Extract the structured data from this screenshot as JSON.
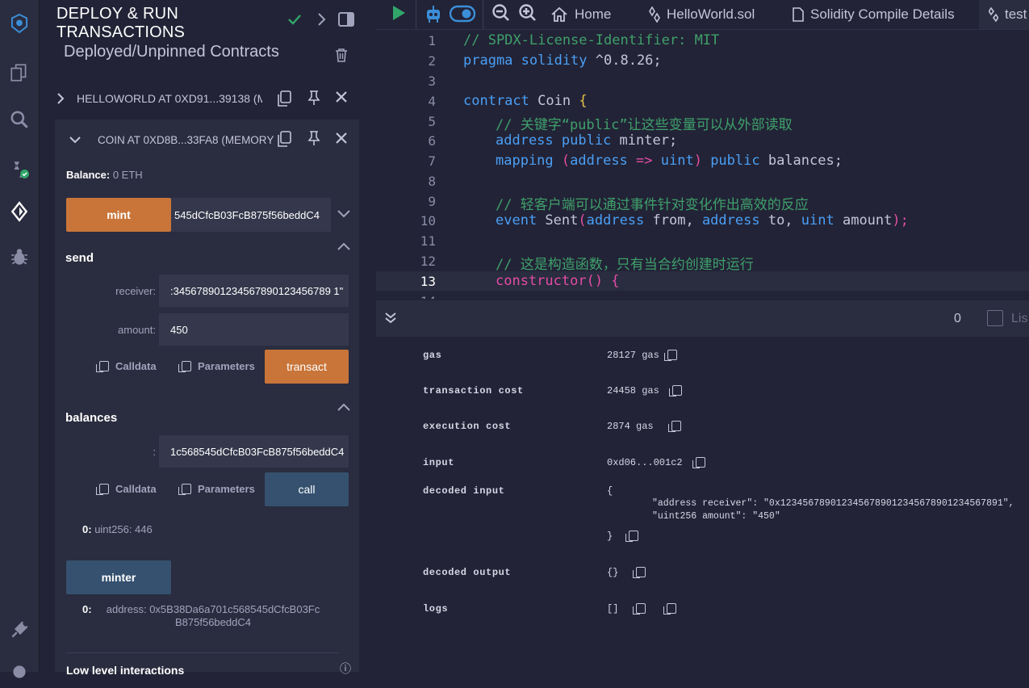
{
  "sidebar_icons": [
    "remix-logo-icon",
    "file-explorer-icon",
    "search-icon",
    "solidity-compiler-icon",
    "deploy-run-icon",
    "debugger-icon",
    "plugin-manager-icon",
    "settings-icon"
  ],
  "panel": {
    "title": "DEPLOY & RUN TRANSACTIONS",
    "subtitle": "Deployed/Unpinned Contracts",
    "contracts": [
      {
        "label": "HELLOWORLD AT 0XD91...39138 (M"
      },
      {
        "label": "COIN AT 0XD8B...33FA8 (MEMORY)"
      }
    ],
    "balance_label": "Balance:",
    "balance_value": "0 ETH",
    "mint": {
      "label": "mint",
      "value": "545dCfcB03FcB875f56beddC4"
    },
    "send": {
      "label": "send",
      "receiver_label": "receiver:",
      "receiver_value": "2345678901234567890123456789 1\"",
      "amount_label": "amount:",
      "amount_value": "450",
      "calldata": "Calldata",
      "parameters": "Parameters",
      "action": "transact"
    },
    "balances": {
      "label": "balances",
      "arg_label": ":",
      "arg_value": "1c568545dCfcB03FcB875f56beddC4",
      "calldata": "Calldata",
      "parameters": "Parameters",
      "action": "call",
      "result_index": "0:",
      "result_value": "uint256: 446"
    },
    "minter": {
      "label": "minter",
      "result_index": "0:",
      "result_line1": "address: 0x5B38Da6a701c568545dCfcB03Fc",
      "result_line2": "B875f56beddC4"
    },
    "low_level": "Low level interactions"
  },
  "topbar": {
    "home": "Home",
    "tab1": "HelloWorld.sol",
    "tab2": "Solidity Compile Details",
    "tab3": "test"
  },
  "editor": {
    "active_line": 13,
    "lines": [
      {
        "n": "1"
      },
      {
        "n": "2"
      },
      {
        "n": "3"
      },
      {
        "n": "4"
      },
      {
        "n": "5"
      },
      {
        "n": "6"
      },
      {
        "n": "7"
      },
      {
        "n": "8"
      },
      {
        "n": "9"
      },
      {
        "n": "10"
      },
      {
        "n": "11"
      },
      {
        "n": "12"
      },
      {
        "n": "13"
      },
      {
        "n": "14"
      }
    ],
    "code": {
      "l1": "// SPDX-License-Identifier: MIT",
      "l2_kw": "pragma solidity",
      "l2_rest": " ^0.8.26;",
      "l4_kw": "contract",
      "l4_rest": " Coin ",
      "l4_brace": "{",
      "l5": "// 关键字“public”让这些变量可以从外部读取",
      "l6_kw": "address public",
      "l6_rest": " minter;",
      "l7_kw": "mapping",
      "l7_p1": " (",
      "l7_kw2": "address",
      "l7_arrow": " =>",
      "l7_kw3": " uint",
      "l7_p2": ")",
      "l7_kw4": " public",
      "l7_rest": " balances;",
      "l9": "// 轻客户端可以通过事件针对变化作出高效的反应",
      "l10_kw": "event",
      "l10_rest": " Sent",
      "l10_p1": "(",
      "l10_a": "address",
      "l10_b": " from, ",
      "l10_c": "address",
      "l10_d": " to, ",
      "l10_e": "uint",
      "l10_f": " amount",
      "l10_p2": ");",
      "l12": "// 这是构造函数，只有当合约创建时运行",
      "l13_kw": "constructor",
      "l13_rest": "() {"
    }
  },
  "terminal": {
    "count": "0",
    "list_label": "Lis",
    "rows": {
      "gas_k": "gas",
      "gas_v": "28127 gas",
      "tc_k": "transaction cost",
      "tc_v": "24458 gas",
      "ec_k": "execution cost",
      "ec_v": "2874 gas",
      "in_k": "input",
      "in_v": "0xd06...001c2",
      "di_k": "decoded input",
      "di_open": "{",
      "di_line1": "\"address receiver\": \"0x1234567890123456789012345678901234567891\",",
      "di_line2": "\"uint256 amount\": \"450\"",
      "di_close": "}",
      "do_k": "decoded output",
      "do_v": "{}",
      "logs_k": "logs",
      "logs_v": "[]"
    }
  }
}
